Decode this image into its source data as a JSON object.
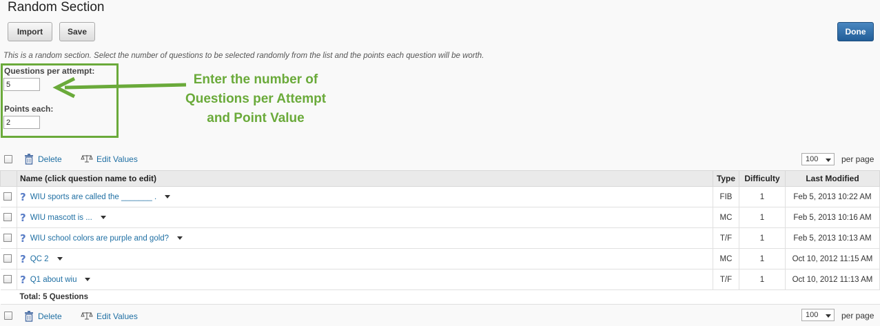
{
  "page": {
    "title": "Random Section"
  },
  "buttons": {
    "import": "Import",
    "save": "Save",
    "done": "Done"
  },
  "description": "This is a random section. Select the number of questions to be selected randomly from the list and the points each question will be worth.",
  "form": {
    "questions_label": "Questions per attempt:",
    "questions_value": "5",
    "points_label": "Points each:",
    "points_value": "2"
  },
  "callout": {
    "line1": "Enter the number of",
    "line2": "Questions per Attempt",
    "line3": "and Point Value",
    "color": "#6aaa3a"
  },
  "toolbar": {
    "delete": "Delete",
    "edit_values": "Edit Values",
    "per_page_value": "100",
    "per_page_label": "per page"
  },
  "table": {
    "headers": {
      "name": "Name (click question name to edit)",
      "type": "Type",
      "difficulty": "Difficulty",
      "last_modified": "Last Modified"
    },
    "rows": [
      {
        "name": "WIU sports are called the _______ .",
        "type": "FIB",
        "difficulty": "1",
        "modified": "Feb 5, 2013 10:22 AM"
      },
      {
        "name": "WIU mascott is ...",
        "type": "MC",
        "difficulty": "1",
        "modified": "Feb 5, 2013 10:16 AM"
      },
      {
        "name": "WIU school colors are purple and gold?",
        "type": "T/F",
        "difficulty": "1",
        "modified": "Feb 5, 2013 10:13 AM"
      },
      {
        "name": "QC 2",
        "type": "MC",
        "difficulty": "1",
        "modified": "Oct 10, 2012 11:15 AM"
      },
      {
        "name": "Q1 about wiu",
        "type": "T/F",
        "difficulty": "1",
        "modified": "Oct 10, 2012 11:13 AM"
      }
    ],
    "total": "Total: 5 Questions"
  },
  "icons": {
    "trash": "trash-icon",
    "edit": "scales-icon",
    "question": "question-icon",
    "menu": "chevron-down-icon"
  }
}
